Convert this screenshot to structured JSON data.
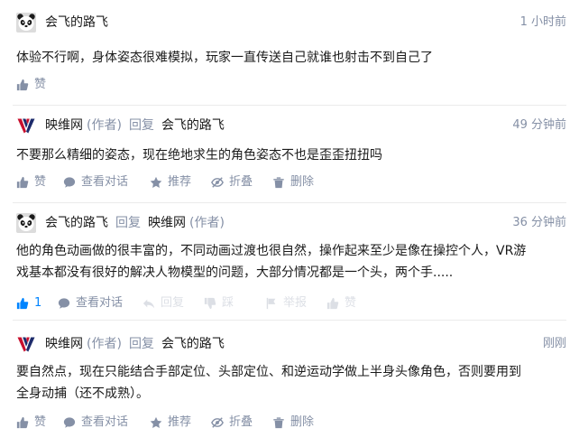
{
  "comments": [
    {
      "author": "会飞的路飞",
      "author_avatar_icon": "panda-avatar",
      "time": "1 小时前",
      "content": "体验不行啊，身体姿态很难模拟，玩家一直传送自己就谁也射击不到自己了",
      "actions": {
        "like": "赞"
      }
    },
    {
      "author": "映维网",
      "author_avatar_icon": "yingwei-logo",
      "author_tag": "(作者)",
      "reply_word": "回复",
      "reply_to": "会飞的路飞",
      "time": "49 分钟前",
      "content": "不要那么精细的姿态，现在绝地求生的角色姿态不也是歪歪扭扭吗",
      "actions": {
        "like": "赞",
        "view_dialog": "查看对话",
        "recommend": "推荐",
        "fold": "折叠",
        "delete": "删除"
      }
    },
    {
      "author": "会飞的路飞",
      "author_avatar_icon": "panda-avatar",
      "reply_word": "回复",
      "reply_to": "映维网",
      "reply_to_tag": "(作者)",
      "time": "36 分钟前",
      "content_lines": [
        "他的角色动画做的很丰富的，不同动画过渡也很自然，操作起来至少是像在操控个人，VR游",
        "戏基本都没有很好的解决人物模型的问题，大部分情况都是一个头，两个手....."
      ],
      "actions": {
        "like_count": "1",
        "view_dialog": "查看对话",
        "reply": "回复",
        "dislike": "踩",
        "report": "举报",
        "faded_like": "赞"
      }
    },
    {
      "author": "映维网",
      "author_avatar_icon": "yingwei-logo",
      "author_tag": "(作者)",
      "reply_word": "回复",
      "reply_to": "会飞的路飞",
      "time": "刚刚",
      "content_lines": [
        "要自然点，现在只能结合手部定位、头部定位、和逆运动学做上半身头像角色，否则要用到",
        "全身动捕（还不成熟）。"
      ],
      "actions": {
        "like": "赞",
        "view_dialog": "查看对话",
        "recommend": "推荐",
        "fold": "折叠",
        "delete": "删除"
      }
    }
  ],
  "colors": {
    "accent": "#0084ff",
    "meta": "#8590a6",
    "text": "#1a1a1a",
    "divider": "#ebebeb",
    "logo_red": "#c8102e",
    "logo_navy": "#1d2b6b"
  }
}
